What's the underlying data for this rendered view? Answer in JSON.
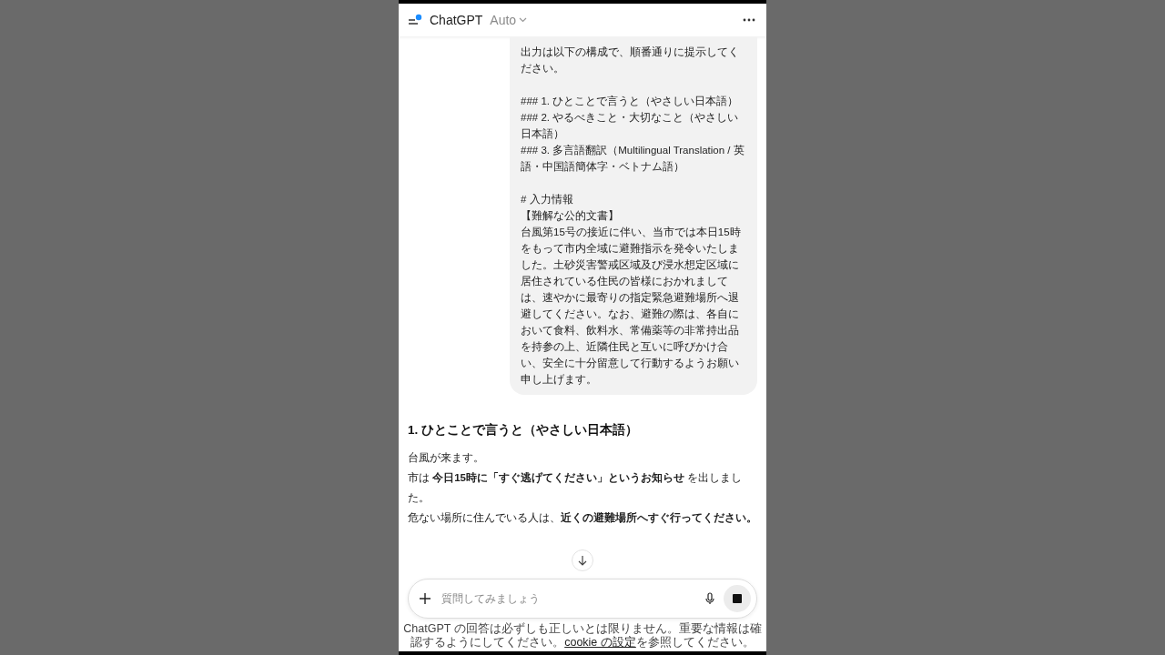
{
  "header": {
    "title": "ChatGPT",
    "model": "Auto"
  },
  "user_message": {
    "blocks": [
      {
        "lines": [
          "出力は以下の構成で、順番通りに提示してください。"
        ]
      },
      {
        "lines": [
          "### 1. ひとことで言うと（やさしい日本語）",
          "### 2. やるべきこと・大切なこと（やさしい日本語）",
          "### 3. 多言語翻訳（Multilingual Translation / 英語・中国語簡体字・ベトナム語）"
        ]
      },
      {
        "lines": [
          "# 入力情報",
          "【難解な公的文書】",
          "台風第15号の接近に伴い、当市では本日15時をもって市内全域に避難指示を発令いたしました。土砂災害警戒区域及び浸水想定区域に居住されている住民の皆様におかれましては、速やかに最寄りの指定緊急避難場所へ退避してください。なお、避難の際は、各自において食料、飲料水、常備薬等の非常持出品を持参の上、近隣住民と互いに呼びかけ合い、安全に十分留意して行動するようお願い申し上げます。"
        ]
      }
    ]
  },
  "answer": {
    "heading": "1. ひとことで言うと（やさしい日本語）",
    "lines": [
      "台風が来ます。",
      "市は **今日15時に「すぐ逃げてください」というお知らせ** を出しました。",
      "危ない場所に住んでいる人は、**近くの避難場所へすぐ行ってください。**"
    ]
  },
  "composer": {
    "placeholder": "質問してみましょう"
  },
  "footer": {
    "text_before": "ChatGPT の回答は必ずしも正しいとは限りません。重要な情報は確認するようにしてください。",
    "link": "cookie の設定",
    "text_after": "を参照してください。"
  }
}
